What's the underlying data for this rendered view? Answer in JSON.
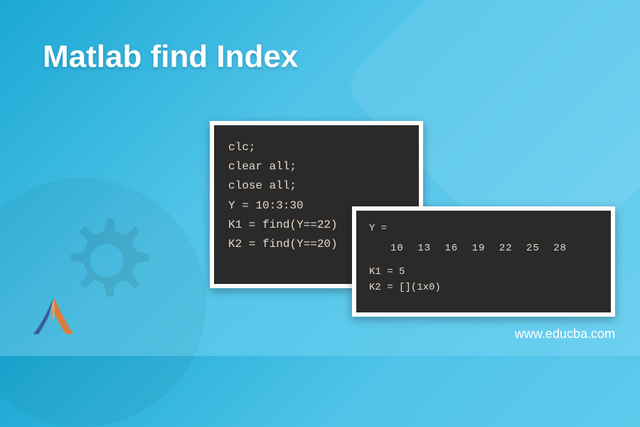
{
  "title": "Matlab find Index",
  "code1": {
    "line1": "clc;",
    "line2": "clear all;",
    "line3": "close all;",
    "line4": "Y = 10:3:30",
    "line5": "K1 = find(Y==22)",
    "line6": "K2 = find(Y==20)"
  },
  "code2": {
    "line1": "Y =",
    "values": "10 13 16 19 22 25 28",
    "line3": "K1 = 5",
    "line4": "K2 = [](1x0)"
  },
  "url": "www.educba.com"
}
